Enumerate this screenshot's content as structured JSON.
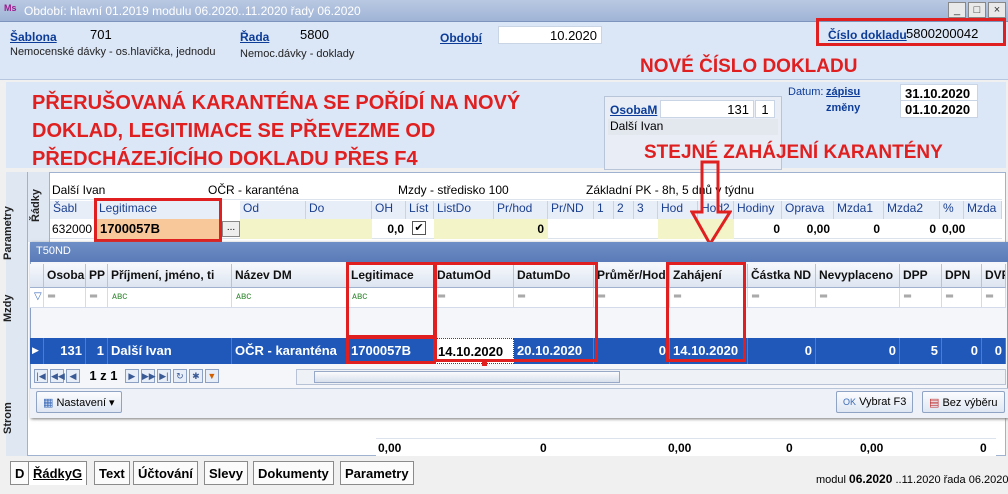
{
  "window": {
    "title": "Období: hlavní 01.2019 modulu 06.2020..11.2020 řady 06.2020",
    "app_icon": "Ms",
    "buttons": [
      "_",
      "□",
      "×"
    ]
  },
  "header": {
    "sablona_label": "Šablona",
    "sablona_value": "701",
    "sablona_desc": "Nemocenské dávky - os.hlavička, jednodu",
    "rada_label": "Řada",
    "rada_value": "5800",
    "rada_desc": "Nemoc.dávky - doklady",
    "obdobi_label": "Období",
    "obdobi_value": "10.2020",
    "cislo_label": "Číslo dokladu",
    "cislo_value": "5800200042"
  },
  "annotations": {
    "nove_cislo": "NOVÉ ČÍSLO DOKLADU",
    "main_note_line1": "PŘERUŠOVANÁ KARANTÉNA SE POŘÍDÍ NA NOVÝ",
    "main_note_line2": "DOKLAD, LEGITIMACE SE PŘEVEZME OD",
    "main_note_line3": "PŘEDCHÁZEJÍCÍHO DOKLADU PŘES F4",
    "stejne": "STEJNÉ ZAHÁJENÍ KARANTÉNY"
  },
  "osoba": {
    "label": "OsobaM",
    "id": "131",
    "pp": "1",
    "name": "Další Ivan"
  },
  "datum": {
    "label": "Datum:",
    "zapisu_label": "zápisu",
    "zapisu_value": "31.10.2020",
    "zmeny_label": "změny",
    "zmeny_value": "01.10.2020"
  },
  "side_tabs": [
    "Parametry",
    "Řádky",
    "Mzdy",
    "Strom"
  ],
  "info_row": {
    "name": "Další Ivan",
    "ocr": "OČR - karanténa",
    "stredisko": "Mzdy - středisko 100",
    "pk": "Základní PK - 8h, 5 dnů v týdnu"
  },
  "rows_grid": {
    "headers": [
      "Šabl",
      "Legitimace",
      "Od",
      "Do",
      "OH",
      "Líst",
      "ListDo",
      "Pr/hod",
      "Pr/ND",
      "1",
      "2",
      "3",
      "Hod",
      "Hod2",
      "Hodiny",
      "Oprava",
      "Mzda1",
      "Mzda2",
      "%",
      "Mzda"
    ],
    "row": {
      "sabl": "632000",
      "legitimace": "1700057B",
      "ellipsis": "...",
      "oh": "0,0",
      "check": "✔",
      "prhod": "0",
      "hodiny": "0",
      "oprava": "0,00",
      "mzda1": "0",
      "mzda2": "0",
      "pct": "0,00"
    },
    "bottom_row": {
      "c1": "0,00",
      "c2": "0",
      "c3": "0,00",
      "c4": "0",
      "c5": "0,00",
      "c6": "0"
    }
  },
  "popup": {
    "title": "T50ND",
    "columns": [
      "Osoba",
      "PP",
      "Příjmení, jméno, ti",
      "Název DM",
      "Legitimace",
      "DatumOd",
      "DatumDo",
      "Průměr/Hod",
      "Zahájení",
      "Částka ND",
      "Nevyplaceno",
      "DPP",
      "DPN",
      "DVP"
    ],
    "filter_symbol": "═",
    "filter_abc": "ᴀʙᴄ",
    "row": {
      "osoba": "131",
      "pp": "1",
      "jmeno": "Další Ivan",
      "dm": "OČR - karanténa",
      "legitimace": "1700057B",
      "datum_od": "14.10.2020",
      "datum_do": "20.10.2020",
      "prumer": "0",
      "zahajeni": "14.10.2020",
      "castka": "0",
      "nevyplaceno": "0",
      "dpp": "5",
      "dpn": "0",
      "dvp": "0"
    },
    "pager": "1 z 1",
    "settings_button": "Nastavení",
    "select_button": "Vybrat F3",
    "no_select_button": "Bez výběru"
  },
  "bottom_tabs": [
    "D",
    "ŘádkyG",
    "Text",
    "Účtování",
    "Slevy",
    "Dokumenty",
    "Parametry"
  ],
  "status": {
    "modul_label": "modul",
    "modul_value": "06.2020",
    "range": "11.2020",
    "rada_label": "řada",
    "rada_value": "06.2020"
  }
}
